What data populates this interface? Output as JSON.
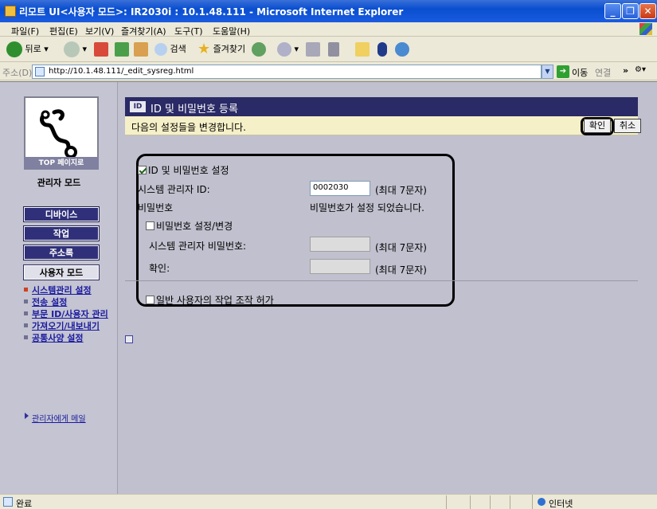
{
  "window": {
    "title": "리모트 UI<사용자 모드>: IR2030i : 10.1.48.111 - Microsoft Internet Explorer"
  },
  "menu": {
    "items": [
      "파일(F)",
      "편집(E)",
      "보기(V)",
      "즐겨찾기(A)",
      "도구(T)",
      "도움말(H)"
    ]
  },
  "toolbar": {
    "back_label": "뒤로",
    "search_label": "검색",
    "favorites_label": "즐겨찾기"
  },
  "address": {
    "label": "주소(D)",
    "url": "http://10.1.48.111/_edit_sysreg.html",
    "go_label": "이동",
    "links_label": "연결"
  },
  "sidebar": {
    "top_page_label": "TOP 페이지로",
    "mode_title": "관리자 모드",
    "nav": {
      "device": "디바이스",
      "job": "작업",
      "address_book": "주소록",
      "user_mode": "사용자 모드"
    },
    "links": [
      {
        "label": "시스템관리 설정",
        "active": true
      },
      {
        "label": "전송 설정",
        "active": false
      },
      {
        "label": "부문 ID/사용자 관리",
        "active": false
      },
      {
        "label": "가져오기/내보내기",
        "active": false
      },
      {
        "label": "공통사양 설정",
        "active": false
      }
    ],
    "mail_link": "관리자에게 메일"
  },
  "main": {
    "header_title": "ID 및 비밀번호 등록",
    "header_icon_text": "ID",
    "notice": "다음의 설정들을 변경합니다.",
    "ok_label": "확인",
    "cancel_label": "취소",
    "id_pw_setting_label": "ID 및 비밀번호 설정",
    "id_pw_setting_checked": true,
    "sys_admin_id_label": "시스템 관리자 ID:",
    "sys_admin_id_value": "0002030",
    "max7_label": "(최대 7문자)",
    "password_label": "비밀번호",
    "password_status": "비밀번호가 설정 되었습니다.",
    "pw_change_label": "비밀번호 설정/변경",
    "pw_change_checked": false,
    "sys_admin_pw_label": "시스템 관리자 비밀번호:",
    "confirm_label": "확인:",
    "allow_general_label": "일반 사용자의 작업 조작 허가",
    "allow_general_checked": false
  },
  "status": {
    "text": "완료",
    "zone": "인터넷"
  }
}
